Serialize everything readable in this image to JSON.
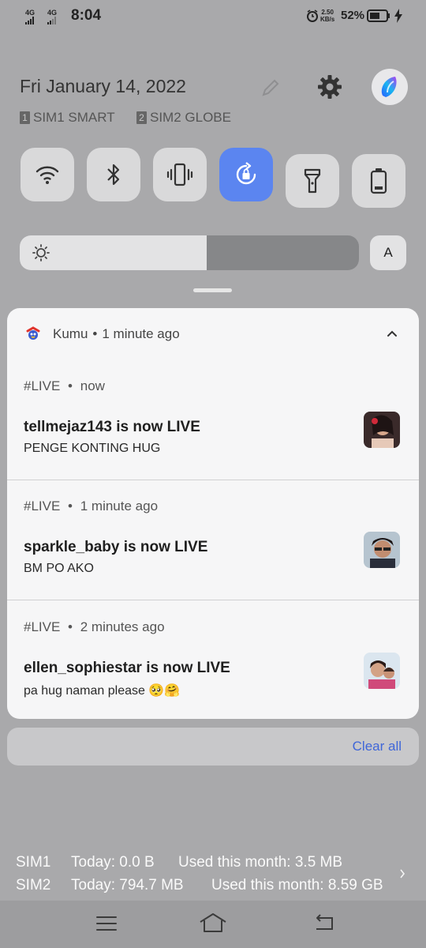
{
  "status": {
    "net1": "4G",
    "net2": "4G",
    "time": "8:04",
    "speed_value": "2.50",
    "speed_unit": "KB/s",
    "battery": "52%"
  },
  "header": {
    "date": "Fri January 14, 2022",
    "sim1_num": "1",
    "sim1_label": "SIM1 SMART",
    "sim2_num": "2",
    "sim2_label": "SIM2 GLOBE"
  },
  "tiles": [
    {
      "icon": "wifi-icon",
      "active": false
    },
    {
      "icon": "bluetooth-icon",
      "active": false
    },
    {
      "icon": "vibrate-icon",
      "active": false
    },
    {
      "icon": "rotation-lock-icon",
      "active": true
    },
    {
      "icon": "flashlight-icon",
      "active": false
    },
    {
      "icon": "battery-saver-icon",
      "active": false
    }
  ],
  "brightness": {
    "level": 0.55,
    "auto_label": "A"
  },
  "notification": {
    "app_name": "Kumu",
    "app_time": "1 minute ago",
    "accent": "#3f66d8",
    "items": [
      {
        "tag": "#LIVE",
        "time": "now",
        "title": "tellmejaz143 is now LIVE",
        "body": "PENGE KONTING HUG"
      },
      {
        "tag": "#LIVE",
        "time": "1 minute ago",
        "title": "sparkle_baby is now LIVE",
        "body": "BM PO AKO"
      },
      {
        "tag": "#LIVE",
        "time": "2 minutes ago",
        "title": "ellen_sophiestar is now LIVE",
        "body": "pa hug naman please 🥺🤗"
      }
    ],
    "clear_label": "Clear all"
  },
  "usage": {
    "sim1": {
      "name": "SIM1",
      "today": "Today: 0.0 B",
      "month": "Used this month: 3.5 MB"
    },
    "sim2": {
      "name": "SIM2",
      "today": "Today: 794.7 MB",
      "month": "Used this month: 8.59 GB"
    }
  }
}
